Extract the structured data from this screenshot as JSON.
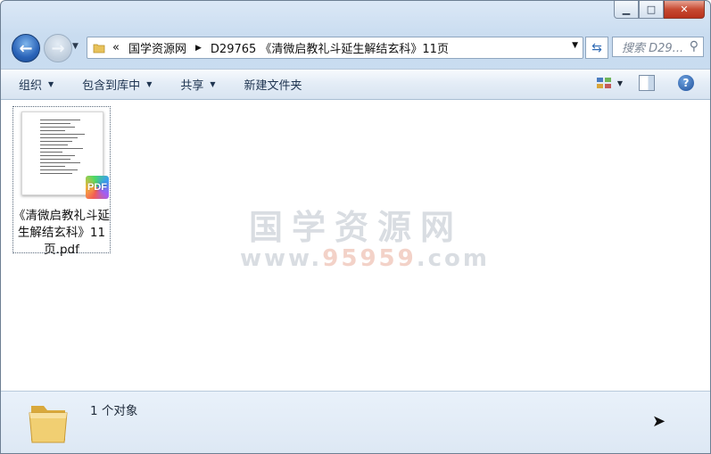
{
  "address": {
    "overflow": "«",
    "crumbs": [
      "国学资源网",
      "D29765 《清微启教礼斗延生解结玄科》11页"
    ]
  },
  "search": {
    "placeholder": "搜索 D29..."
  },
  "toolbar": {
    "organize": "组织",
    "include_library": "包含到库中",
    "share": "共享",
    "new_folder": "新建文件夹"
  },
  "files": [
    {
      "name": "《清微启教礼斗延生解结玄科》11页.pdf",
      "badge": "PDF"
    }
  ],
  "watermark": {
    "line1": "国学资源网",
    "line2_a": "www.",
    "line2_b": "95959",
    "line2_c": ".com"
  },
  "status": {
    "count": "1 个对象"
  },
  "colors": {
    "accent": "#2a63b8",
    "title_bar": "#c9dcf0",
    "close": "#c74a32"
  },
  "icons": [
    "back-arrow-icon",
    "forward-arrow-icon",
    "folder-icon",
    "refresh-icon",
    "search-icon",
    "view-icon",
    "preview-pane-icon",
    "help-icon",
    "pdf-icon"
  ]
}
